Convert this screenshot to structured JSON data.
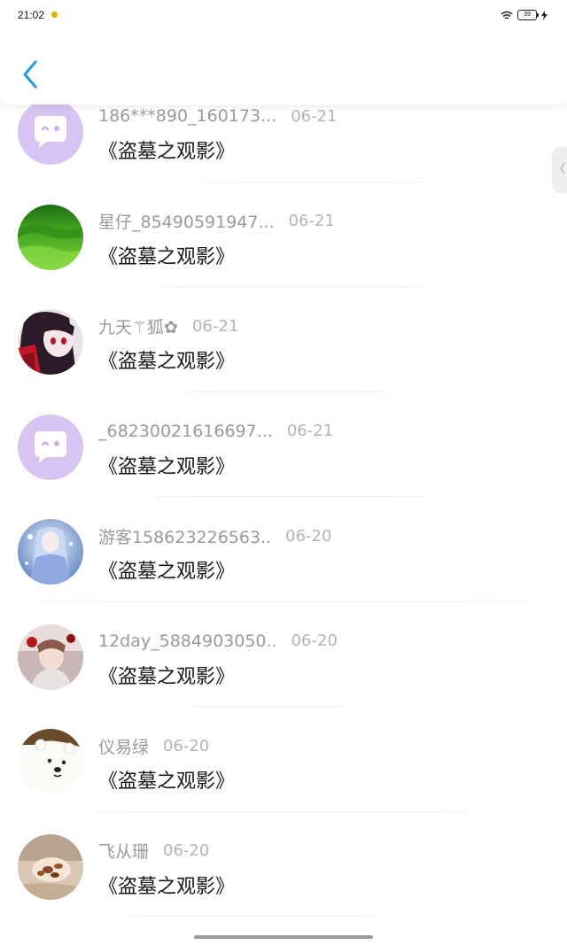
{
  "status_bar": {
    "time": "21:02",
    "battery": "39"
  },
  "header": {
    "back_icon": "chevron-left-icon"
  },
  "colors": {
    "accent": "#2a9de0",
    "name_gray": "#9a9a9a",
    "date_gray": "#b4b4b4",
    "text": "#1a1a1a"
  },
  "side_tab": {
    "label": "〈"
  },
  "comments": [
    {
      "user": "186***890_160173...",
      "date": "06-21",
      "text": "《盗墓之观影》",
      "avatar": "chat-bubble-icon"
    },
    {
      "user": "星仔_85490591947...",
      "date": "06-21",
      "text": "《盗墓之观影》",
      "avatar": "grass-photo"
    },
    {
      "user": "九天⚚狐✿",
      "date": "06-21",
      "text": "《盗墓之观影》",
      "avatar": "anime-girl-red"
    },
    {
      "user": "_68230021616697...",
      "date": "06-21",
      "text": "《盗墓之观影》",
      "avatar": "chat-bubble-icon"
    },
    {
      "user": "游客158623226563..",
      "date": "06-20",
      "text": "《盗墓之观影》",
      "avatar": "anime-girl-blue"
    },
    {
      "user": "12day_5884903050..",
      "date": "06-20",
      "text": "《盗墓之观影》",
      "avatar": "doll-photo"
    },
    {
      "user": "仪易绿",
      "date": "06-20",
      "text": "《盗墓之观影》",
      "avatar": "polar-bear"
    },
    {
      "user": "飞从珊",
      "date": "06-20",
      "text": "《盗墓之观影》",
      "avatar": "seashell-photo"
    }
  ]
}
